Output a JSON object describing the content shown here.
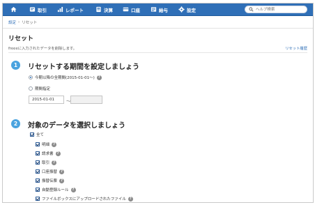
{
  "nav": {
    "items": [
      {
        "label": "取引",
        "icon": "transaction-icon"
      },
      {
        "label": "レポート",
        "icon": "report-icon"
      },
      {
        "label": "決算",
        "icon": "closing-icon"
      },
      {
        "label": "口座",
        "icon": "bank-account-icon"
      },
      {
        "label": "給与",
        "icon": "payroll-icon"
      },
      {
        "label": "設定",
        "icon": "gear-icon"
      }
    ],
    "search_placeholder": "ヘルプ検索"
  },
  "breadcrumb": {
    "parent": "設定",
    "separator": "›",
    "current": "リセット"
  },
  "page": {
    "title": "リセット",
    "description": "freeeに入力されたデータを削除します。",
    "history_link": "リセット履歴"
  },
  "step1": {
    "number": "1",
    "title": "リセットする期間を設定しましょう",
    "option_all": "今期以降の全期間(2015-01-01〜)",
    "option_range": "期間指定",
    "start_date": "2015-01-01",
    "range_separator": "〜",
    "end_date": ""
  },
  "step2": {
    "number": "2",
    "title": "対象のデータを選択しましょう",
    "all_label": "全て",
    "items": [
      {
        "label": "明細"
      },
      {
        "label": "請求書"
      },
      {
        "label": "取引"
      },
      {
        "label": "口座振替"
      },
      {
        "label": "振替伝票"
      },
      {
        "label": "自動登録ルール"
      },
      {
        "label": "ファイルボックスにアップロードされたファイル"
      }
    ]
  },
  "colors": {
    "nav_bg": "#2f6fb7",
    "step_circle": "#4aa3df",
    "link": "#2f6fb7"
  }
}
